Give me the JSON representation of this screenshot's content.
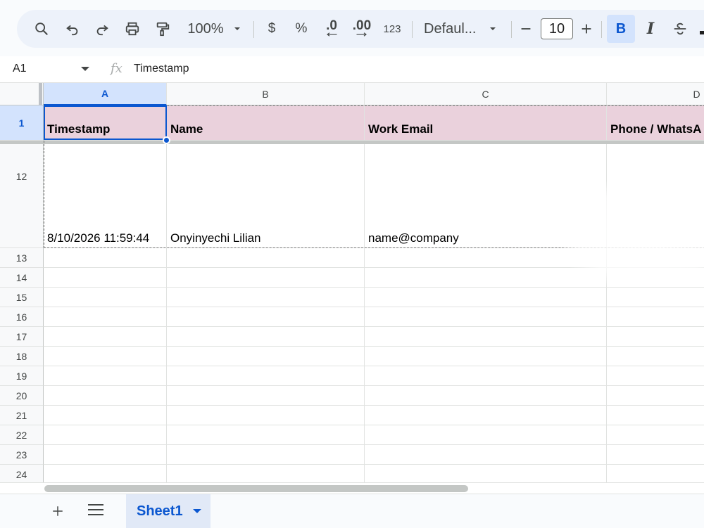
{
  "toolbar": {
    "zoom": "100%",
    "currency": "$",
    "percent": "%",
    "decrease_decimal": ".0",
    "increase_decimal": ".00",
    "more_formats": "123",
    "font": "Defaul...",
    "font_size": "10",
    "bold": "B",
    "italic": "I",
    "icons": [
      "search-icon",
      "undo-icon",
      "redo-icon",
      "print-icon",
      "paint-format-icon",
      "decrease-font-icon",
      "increase-font-icon",
      "strikethrough-icon"
    ]
  },
  "formula_bar": {
    "cell_ref": "A1",
    "fx": "fx",
    "content": "Timestamp"
  },
  "columns": [
    "A",
    "B",
    "C",
    "D"
  ],
  "rows": {
    "header_row_number": "1",
    "headers": [
      "Timestamp",
      "Name",
      "Work Email",
      "Phone / WhatsA"
    ],
    "data_row_number": "12",
    "data": [
      "8/10/2026 11:59:44",
      "Onyinyechi Lilian",
      "name@company",
      ""
    ],
    "empty_row_numbers": [
      "13",
      "14",
      "15",
      "16",
      "17",
      "18",
      "19",
      "20",
      "21",
      "22",
      "23",
      "24"
    ]
  },
  "sheets": {
    "active_tab": "Sheet1"
  },
  "colors": {
    "header_fill": "#ead1dc",
    "selection": "#0b57d0",
    "selected_header_bg": "#d3e3fd"
  }
}
